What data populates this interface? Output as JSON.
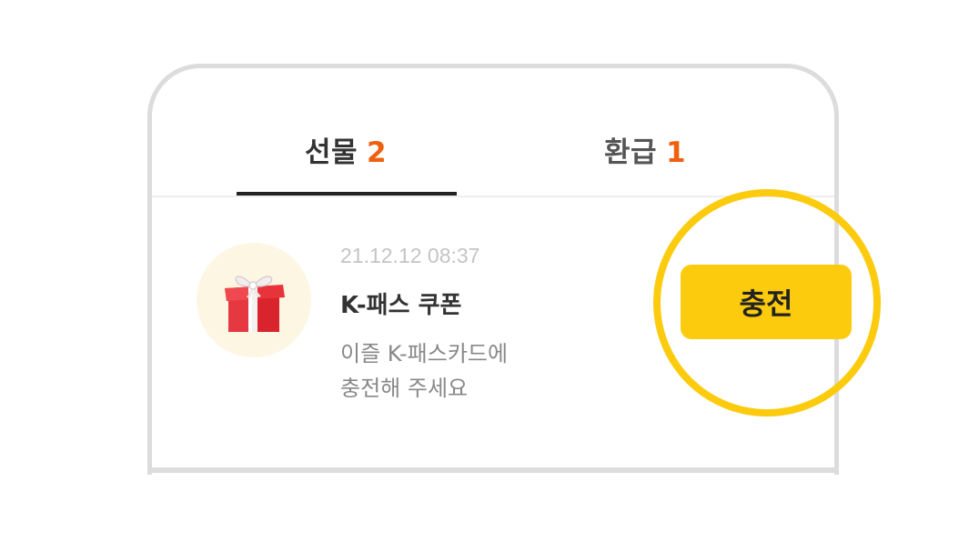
{
  "tabs": [
    {
      "label": "선물",
      "count": "2"
    },
    {
      "label": "환급",
      "count": "1"
    }
  ],
  "item": {
    "date": "21.12.12 08:37",
    "title": "K-패스 쿠폰",
    "desc_line1": "이즐 K-패스카드에",
    "desc_line2": "충전해 주세요"
  },
  "action": {
    "charge_label": "충전"
  },
  "icons": {
    "gift": "gift-icon"
  },
  "colors": {
    "accent_yellow": "#fccb0e",
    "count_orange": "#f0600f",
    "gift_circle_bg": "#fdf6e3"
  }
}
